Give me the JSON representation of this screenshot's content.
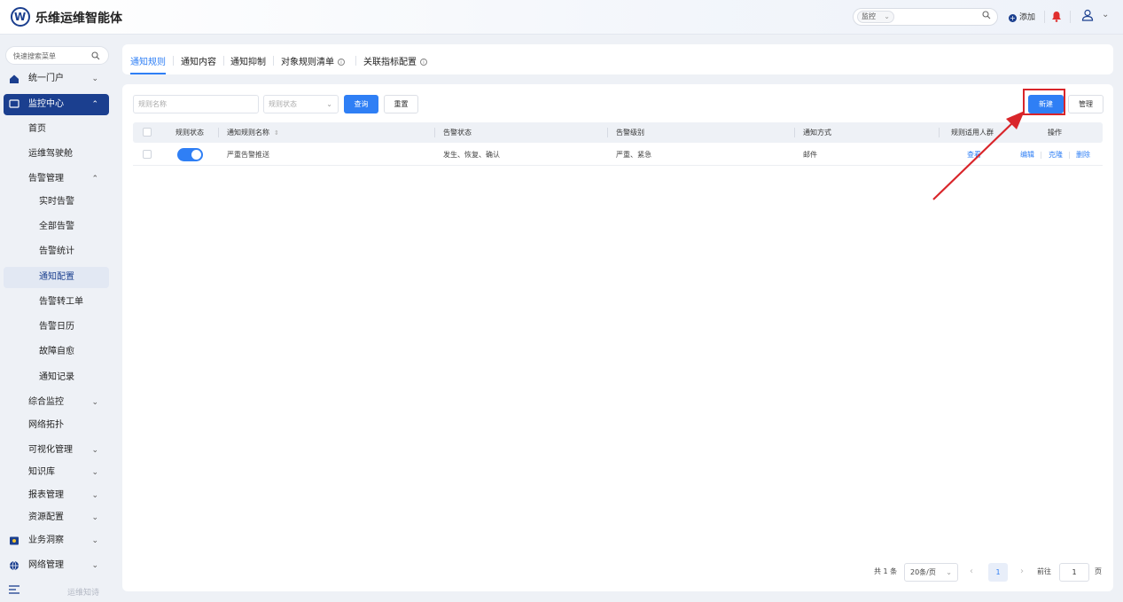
{
  "header": {
    "app_title": "乐维运维智能体",
    "logo_letter": "W",
    "search_scope": "监控",
    "search_placeholder": "",
    "add_label": "添加"
  },
  "sidebar": {
    "search_placeholder": "快速搜索菜单",
    "items": [
      {
        "label": "统一门户",
        "expanded": false
      },
      {
        "label": "监控中心",
        "expanded": true
      },
      {
        "label": "首页"
      },
      {
        "label": "运维驾驶舱"
      },
      {
        "label": "告警管理",
        "expanded": true
      },
      {
        "label": "实时告警"
      },
      {
        "label": "全部告警"
      },
      {
        "label": "告警统计"
      },
      {
        "label": "通知配置",
        "selected": true
      },
      {
        "label": "告警转工单"
      },
      {
        "label": "告警日历"
      },
      {
        "label": "故障自愈"
      },
      {
        "label": "通知记录"
      },
      {
        "label": "综合监控"
      },
      {
        "label": "网络拓扑"
      },
      {
        "label": "可视化管理"
      },
      {
        "label": "知识库"
      },
      {
        "label": "报表管理"
      },
      {
        "label": "资源配置"
      },
      {
        "label": "业务洞察"
      },
      {
        "label": "网络管理"
      }
    ],
    "footer_text": "运维知诗"
  },
  "tabs": [
    {
      "label": "通知规则",
      "active": true
    },
    {
      "label": "通知内容"
    },
    {
      "label": "通知抑制"
    },
    {
      "label": "对象规则清单"
    },
    {
      "label": "关联指标配置"
    }
  ],
  "filters": {
    "name_placeholder": "规则名称",
    "status_placeholder": "规则状态",
    "query_label": "查询",
    "reset_label": "重置",
    "new_label": "新建",
    "manage_label": "管理"
  },
  "table": {
    "columns": [
      "规则状态",
      "通知规则名称",
      "告警状态",
      "告警级别",
      "通知方式",
      "规则适用人群",
      "操作"
    ],
    "rows": [
      {
        "enabled": true,
        "name": "严重告警推送",
        "alert_status": "发生、恢复、确认",
        "alert_level": "严重、紧急",
        "notify_method": "邮件",
        "audience_link": "查看",
        "actions": [
          "编辑",
          "克隆",
          "删除"
        ]
      }
    ]
  },
  "pagination": {
    "total_text": "共 1 条",
    "page_size": "20条/页",
    "current_page": "1",
    "goto_label": "前往",
    "goto_value": "1",
    "page_suffix": "页"
  },
  "colors": {
    "brand": "#1b3f8f",
    "primary": "#2f7ff5",
    "highlight": "#d9252a"
  }
}
